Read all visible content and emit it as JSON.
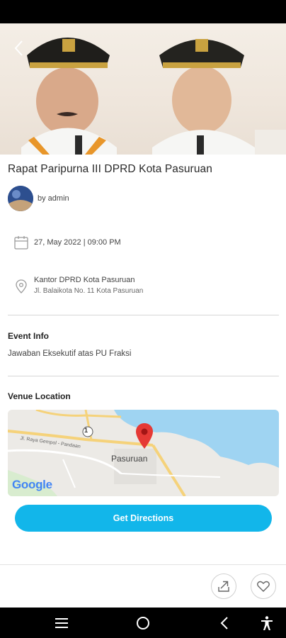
{
  "event": {
    "title": "Rapat Paripurna III DPRD Kota Pasuruan",
    "author": "by admin",
    "datetime": "27, May 2022 | 09:00 PM",
    "venue_name": "Kantor DPRD Kota Pasuruan",
    "venue_address": "Jl. Balaikota No. 11 Kota Pasuruan"
  },
  "event_info": {
    "heading": "Event Info",
    "description": "Jawaban Eksekutif atas PU Fraksi"
  },
  "venue_location": {
    "heading": "Venue Location",
    "map_city_label": "Pasuruan",
    "map_road_label": "Jl. Raya Gempol - Pandaan",
    "map_route_badge": "1",
    "map_brand": "Google"
  },
  "actions": {
    "directions_label": "Get Directions"
  },
  "icons": {
    "back": "chevron-left-icon",
    "calendar": "calendar-icon",
    "location": "location-pin-icon",
    "share": "share-icon",
    "favorite": "heart-icon",
    "nav_menu": "menu-icon",
    "nav_home": "home-circle-icon",
    "nav_back": "back-arrow-icon",
    "nav_accessibility": "accessibility-icon"
  },
  "colors": {
    "accent": "#12b6ea",
    "map_pin": "#e53935",
    "map_water": "#9fd4f2"
  }
}
